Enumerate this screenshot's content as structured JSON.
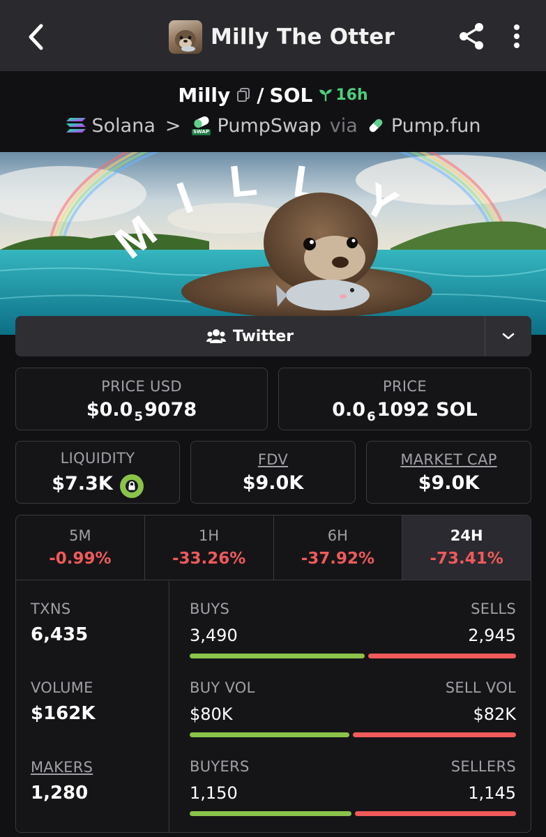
{
  "app_bar": {
    "title": "Milly The Otter",
    "icons": [
      "back-arrow-icon",
      "share-icon",
      "more-vertical-icon"
    ]
  },
  "pair": {
    "base": "Milly",
    "slash": "/",
    "quote": "SOL",
    "age": "16h",
    "chain": "Solana",
    "separator": ">",
    "dex": "PumpSwap",
    "dex_badge": "SWAP",
    "via": "via",
    "launchpad": "Pump.fun"
  },
  "banner": {
    "title_art": "MILLY"
  },
  "links": {
    "twitter_label": "Twitter"
  },
  "prices": {
    "price_usd_label": "PRICE USD",
    "price_usd": {
      "prefix": "$0.0",
      "zeros": "5",
      "digits": "9078"
    },
    "price_label": "PRICE",
    "price_sol": {
      "prefix": "0.0",
      "zeros": "6",
      "digits": "1092 SOL"
    }
  },
  "metrics": {
    "liquidity_label": "LIQUIDITY",
    "liquidity": "$7.3K",
    "fdv_label": "FDV",
    "fdv": "$9.0K",
    "mcap_label": "MARKET CAP",
    "mcap": "$9.0K"
  },
  "timeframes": [
    {
      "label": "5M",
      "change": "-0.99%"
    },
    {
      "label": "1H",
      "change": "-33.26%"
    },
    {
      "label": "6H",
      "change": "-37.92%"
    },
    {
      "label": "24H",
      "change": "-73.41%"
    }
  ],
  "active_timeframe": "24H",
  "stats": {
    "txns_label": "TXNS",
    "txns": "6,435",
    "volume_label": "VOLUME",
    "volume": "$162K",
    "makers_label": "MAKERS",
    "makers": "1,280"
  },
  "bars": {
    "buys_label": "BUYS",
    "buys": "3,490",
    "sells_label": "SELLS",
    "sells": "2,945",
    "buys_fraction": 0.542,
    "buy_vol_label": "BUY VOL",
    "buy_vol": "$80K",
    "sell_vol_label": "SELL VOL",
    "sell_vol": "$82K",
    "buy_vol_fraction": 0.494,
    "buyers_label": "BUYERS",
    "buyers": "1,150",
    "sellers_label": "SELLERS",
    "sellers": "1,145",
    "buyers_fraction": 0.501
  },
  "colors": {
    "positive": "#8bc34a",
    "negative": "#f05a5a",
    "age_green": "#4cd07d",
    "surface": "#2a2a2e"
  }
}
